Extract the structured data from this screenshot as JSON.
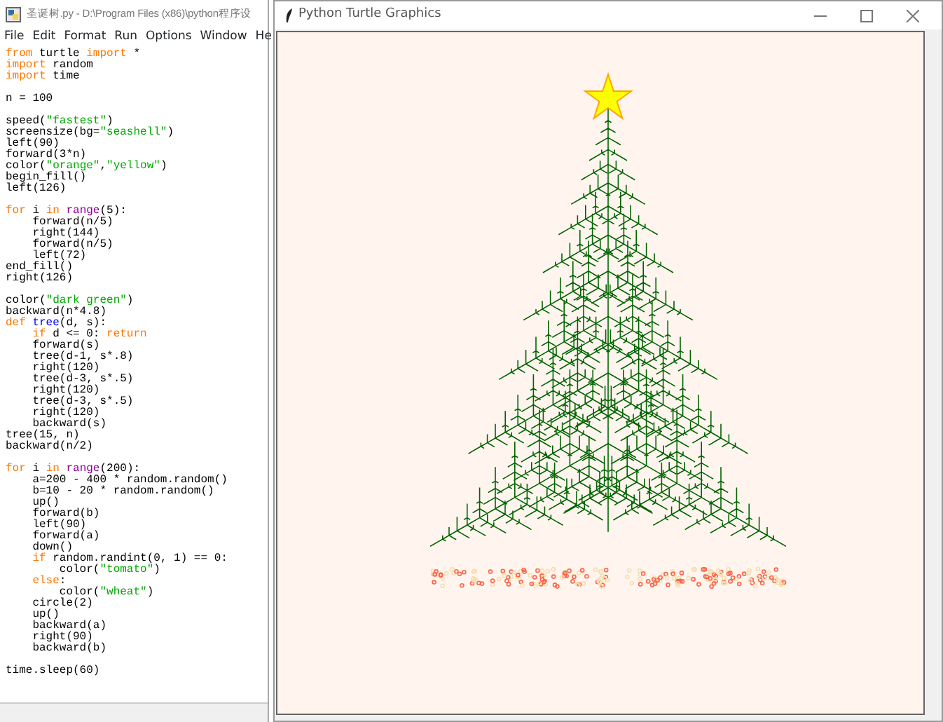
{
  "editor": {
    "title": "圣诞树.py - D:\\Program Files (x86)\\python程序设",
    "menu": [
      "File",
      "Edit",
      "Format",
      "Run",
      "Options",
      "Window",
      "He"
    ],
    "code_lines": [
      {
        "kind": "code",
        "segments": [
          {
            "text": "from",
            "kind": "keyword"
          },
          {
            "text": " turtle ",
            "kind": "plain"
          },
          {
            "text": "import",
            "kind": "keyword"
          },
          {
            "text": " *",
            "kind": "plain"
          }
        ]
      },
      {
        "kind": "code",
        "segments": [
          {
            "text": "import",
            "kind": "keyword"
          },
          {
            "text": " random",
            "kind": "plain"
          }
        ]
      },
      {
        "kind": "code",
        "segments": [
          {
            "text": "import",
            "kind": "keyword"
          },
          {
            "text": " time",
            "kind": "plain"
          }
        ]
      },
      {
        "kind": "blank"
      },
      {
        "kind": "code",
        "segments": [
          {
            "text": "n = 100",
            "kind": "plain"
          }
        ]
      },
      {
        "kind": "blank"
      },
      {
        "kind": "code",
        "segments": [
          {
            "text": "speed(",
            "kind": "plain"
          },
          {
            "text": "\"fastest\"",
            "kind": "string"
          },
          {
            "text": ")",
            "kind": "plain"
          }
        ]
      },
      {
        "kind": "code",
        "segments": [
          {
            "text": "screensize(bg=",
            "kind": "plain"
          },
          {
            "text": "\"seashell\"",
            "kind": "string"
          },
          {
            "text": ")",
            "kind": "plain"
          }
        ]
      },
      {
        "kind": "code",
        "segments": [
          {
            "text": "left(90)",
            "kind": "plain"
          }
        ]
      },
      {
        "kind": "code",
        "segments": [
          {
            "text": "forward(3*n)",
            "kind": "plain"
          }
        ]
      },
      {
        "kind": "code",
        "segments": [
          {
            "text": "color(",
            "kind": "plain"
          },
          {
            "text": "\"orange\"",
            "kind": "string"
          },
          {
            "text": ",",
            "kind": "plain"
          },
          {
            "text": "\"yellow\"",
            "kind": "string"
          },
          {
            "text": ")",
            "kind": "plain"
          }
        ]
      },
      {
        "kind": "code",
        "segments": [
          {
            "text": "begin_fill()",
            "kind": "plain"
          }
        ]
      },
      {
        "kind": "code",
        "segments": [
          {
            "text": "left(126)",
            "kind": "plain"
          }
        ]
      },
      {
        "kind": "blank"
      },
      {
        "kind": "code",
        "segments": [
          {
            "text": "for",
            "kind": "keyword"
          },
          {
            "text": " i ",
            "kind": "plain"
          },
          {
            "text": "in",
            "kind": "keyword"
          },
          {
            "text": " range",
            "kind": "builtin"
          },
          {
            "text": "(5):",
            "kind": "plain"
          }
        ]
      },
      {
        "kind": "code",
        "segments": [
          {
            "text": "    forward(n/5)",
            "kind": "plain"
          }
        ]
      },
      {
        "kind": "code",
        "segments": [
          {
            "text": "    right(144)",
            "kind": "plain"
          }
        ]
      },
      {
        "kind": "code",
        "segments": [
          {
            "text": "    forward(n/5)",
            "kind": "plain"
          }
        ]
      },
      {
        "kind": "code",
        "segments": [
          {
            "text": "    left(72)",
            "kind": "plain"
          }
        ]
      },
      {
        "kind": "code",
        "segments": [
          {
            "text": "end_fill()",
            "kind": "plain"
          }
        ]
      },
      {
        "kind": "code",
        "segments": [
          {
            "text": "right(126)",
            "kind": "plain"
          }
        ]
      },
      {
        "kind": "blank"
      },
      {
        "kind": "code",
        "segments": [
          {
            "text": "color(",
            "kind": "plain"
          },
          {
            "text": "\"dark green\"",
            "kind": "string"
          },
          {
            "text": ")",
            "kind": "plain"
          }
        ]
      },
      {
        "kind": "code",
        "segments": [
          {
            "text": "backward(n*4.8)",
            "kind": "plain"
          }
        ]
      },
      {
        "kind": "code",
        "segments": [
          {
            "text": "def",
            "kind": "keyword"
          },
          {
            "text": " tree",
            "kind": "definition"
          },
          {
            "text": "(d, s):",
            "kind": "plain"
          }
        ]
      },
      {
        "kind": "code",
        "segments": [
          {
            "text": "    if",
            "kind": "keyword"
          },
          {
            "text": " d <= 0: ",
            "kind": "plain"
          },
          {
            "text": "return",
            "kind": "keyword"
          }
        ]
      },
      {
        "kind": "code",
        "segments": [
          {
            "text": "    forward(s)",
            "kind": "plain"
          }
        ]
      },
      {
        "kind": "code",
        "segments": [
          {
            "text": "    tree(d-1, s*.8)",
            "kind": "plain"
          }
        ]
      },
      {
        "kind": "code",
        "segments": [
          {
            "text": "    right(120)",
            "kind": "plain"
          }
        ]
      },
      {
        "kind": "code",
        "segments": [
          {
            "text": "    tree(d-3, s*.5)",
            "kind": "plain"
          }
        ]
      },
      {
        "kind": "code",
        "segments": [
          {
            "text": "    right(120)",
            "kind": "plain"
          }
        ]
      },
      {
        "kind": "code",
        "segments": [
          {
            "text": "    tree(d-3, s*.5)",
            "kind": "plain"
          }
        ]
      },
      {
        "kind": "code",
        "segments": [
          {
            "text": "    right(120)",
            "kind": "plain"
          }
        ]
      },
      {
        "kind": "code",
        "segments": [
          {
            "text": "    backward(s)",
            "kind": "plain"
          }
        ]
      },
      {
        "kind": "code",
        "segments": [
          {
            "text": "tree(15, n)",
            "kind": "plain"
          }
        ]
      },
      {
        "kind": "code",
        "segments": [
          {
            "text": "backward(n/2)",
            "kind": "plain"
          }
        ]
      },
      {
        "kind": "blank"
      },
      {
        "kind": "code",
        "segments": [
          {
            "text": "for",
            "kind": "keyword"
          },
          {
            "text": " i ",
            "kind": "plain"
          },
          {
            "text": "in",
            "kind": "keyword"
          },
          {
            "text": " range",
            "kind": "builtin"
          },
          {
            "text": "(200):",
            "kind": "plain"
          }
        ]
      },
      {
        "kind": "code",
        "segments": [
          {
            "text": "    a=200 - 400 * random.random()",
            "kind": "plain"
          }
        ]
      },
      {
        "kind": "code",
        "segments": [
          {
            "text": "    b=10 - 20 * random.random()",
            "kind": "plain"
          }
        ]
      },
      {
        "kind": "code",
        "segments": [
          {
            "text": "    up()",
            "kind": "plain"
          }
        ]
      },
      {
        "kind": "code",
        "segments": [
          {
            "text": "    forward(b)",
            "kind": "plain"
          }
        ]
      },
      {
        "kind": "code",
        "segments": [
          {
            "text": "    left(90)",
            "kind": "plain"
          }
        ]
      },
      {
        "kind": "code",
        "segments": [
          {
            "text": "    forward(a)",
            "kind": "plain"
          }
        ]
      },
      {
        "kind": "code",
        "segments": [
          {
            "text": "    down()",
            "kind": "plain"
          }
        ]
      },
      {
        "kind": "code",
        "segments": [
          {
            "text": "    if",
            "kind": "keyword"
          },
          {
            "text": " random.randint(0, 1) == 0:",
            "kind": "plain"
          }
        ]
      },
      {
        "kind": "code",
        "segments": [
          {
            "text": "        color(",
            "kind": "plain"
          },
          {
            "text": "\"tomato\"",
            "kind": "string"
          },
          {
            "text": ")",
            "kind": "plain"
          }
        ]
      },
      {
        "kind": "code",
        "segments": [
          {
            "text": "    else",
            "kind": "keyword"
          },
          {
            "text": ":",
            "kind": "plain"
          }
        ]
      },
      {
        "kind": "code",
        "segments": [
          {
            "text": "        color(",
            "kind": "plain"
          },
          {
            "text": "\"wheat\"",
            "kind": "string"
          },
          {
            "text": ")",
            "kind": "plain"
          }
        ]
      },
      {
        "kind": "code",
        "segments": [
          {
            "text": "    circle(2)",
            "kind": "plain"
          }
        ]
      },
      {
        "kind": "code",
        "segments": [
          {
            "text": "    up()",
            "kind": "plain"
          }
        ]
      },
      {
        "kind": "code",
        "segments": [
          {
            "text": "    backward(a)",
            "kind": "plain"
          }
        ]
      },
      {
        "kind": "code",
        "segments": [
          {
            "text": "    right(90)",
            "kind": "plain"
          }
        ]
      },
      {
        "kind": "code",
        "segments": [
          {
            "text": "    backward(b)",
            "kind": "plain"
          }
        ]
      },
      {
        "kind": "blank"
      },
      {
        "kind": "code",
        "segments": [
          {
            "text": "time.sleep(60)",
            "kind": "plain"
          }
        ]
      }
    ]
  },
  "turtle_window": {
    "title": "Python Turtle Graphics"
  }
}
